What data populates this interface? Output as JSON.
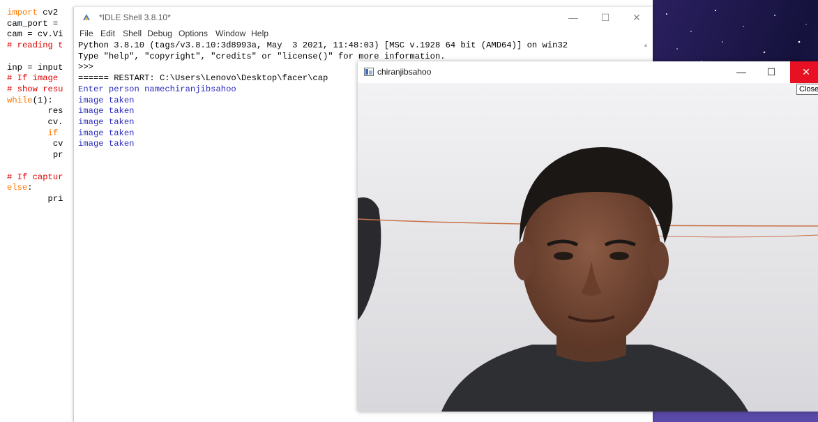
{
  "editor": {
    "lines": [
      {
        "kw": "import",
        "rest": " cv2"
      },
      {
        "kw": "",
        "rest": "cam_port = "
      },
      {
        "kw": "",
        "rest": "cam = cv.Vi"
      },
      {
        "cm": "# reading t"
      },
      {
        "kw": "",
        "rest": ""
      },
      {
        "kw": "",
        "rest": "inp = input"
      },
      {
        "cm": "# If image "
      },
      {
        "cm": "# show resu"
      },
      {
        "kw": "while",
        "rest": "(1):"
      },
      {
        "kw": "",
        "rest": "        res"
      },
      {
        "kw": "",
        "rest": "        cv."
      },
      {
        "kw": "        if",
        "rest": " "
      },
      {
        "kw": "",
        "rest": "         cv"
      },
      {
        "kw": "",
        "rest": "         pr"
      },
      {
        "kw": "",
        "rest": ""
      },
      {
        "cm": "# If captur"
      },
      {
        "kw": "else",
        "rest": ":"
      },
      {
        "kw": "",
        "rest": "        pri"
      }
    ]
  },
  "idle": {
    "title": "*IDLE Shell 3.8.10*",
    "menu": [
      "File",
      "Edit",
      "Shell",
      "Debug",
      "Options",
      "Window",
      "Help"
    ],
    "controls": {
      "minimize": "—",
      "maximize": "☐",
      "close": "✕"
    },
    "output": [
      {
        "text": "Python 3.8.10 (tags/v3.8.10:3d8993a, May  3 2021, 11:48:03) [MSC v.1928 64 bit (AMD64)] on win32",
        "color": "black"
      },
      {
        "text": "Type \"help\", \"copyright\", \"credits\" or \"license()\" for more information.",
        "color": "black"
      },
      {
        "text": ">>> ",
        "color": "black"
      },
      {
        "text": "====== RESTART: C:\\Users\\Lenovo\\Desktop\\facer\\cap",
        "color": "black"
      },
      {
        "text": "Enter person namechiranjibsahoo",
        "color": "blue"
      },
      {
        "text": "image taken",
        "color": "blue"
      },
      {
        "text": "image taken",
        "color": "blue"
      },
      {
        "text": "image taken",
        "color": "blue"
      },
      {
        "text": "image taken",
        "color": "blue"
      },
      {
        "text": "image taken",
        "color": "blue"
      }
    ]
  },
  "camera_window": {
    "title": "chiranjibsahoo",
    "controls": {
      "minimize": "—",
      "maximize": "☐",
      "close": "✕"
    },
    "close_tooltip": "Close"
  },
  "colors": {
    "keyword": "#ff7700",
    "comment": "#dd0000",
    "shell_output": "#2d2dbf",
    "close_red": "#e81123",
    "desktop": "#1c1647"
  }
}
